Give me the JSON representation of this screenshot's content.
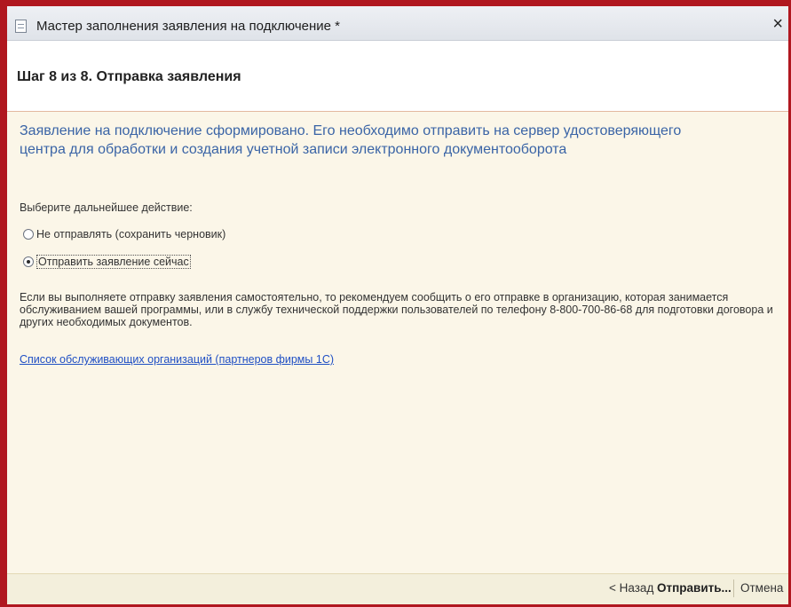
{
  "window": {
    "title": "Мастер заполнения заявления на подключение *",
    "close_label": "×"
  },
  "step": {
    "title": "Шаг 8 из 8. Отправка заявления"
  },
  "main": {
    "headline": "Заявление на подключение сформировано. Его необходимо отправить на сервер удостоверяющего центра для обработки и создания учетной записи электронного документооборота",
    "prompt": "Выберите дальнейшее действие:",
    "options": [
      {
        "label": "Не отправлять (сохранить черновик)",
        "checked": false
      },
      {
        "label": "Отправить заявление сейчас",
        "checked": true
      }
    ],
    "info": "Если вы выполняете отправку заявления самостоятельно, то рекомендуем сообщить о его отправке в организацию, которая занимается обслуживанием вашей программы, или в службу технической поддержки пользователей по телефону 8-800-700-86-68 для подготовки договора и других необходимых документов.",
    "link": "Список обслуживающих организаций (партнеров фирмы 1С)"
  },
  "footer": {
    "back_label": "< Назад",
    "send_label": "Отправить...",
    "cancel_label": "Отмена"
  },
  "colors": {
    "frame": "#b0171f",
    "headline": "#3a64a6",
    "content_bg": "#fbf6e8",
    "link": "#1f4fc4"
  }
}
